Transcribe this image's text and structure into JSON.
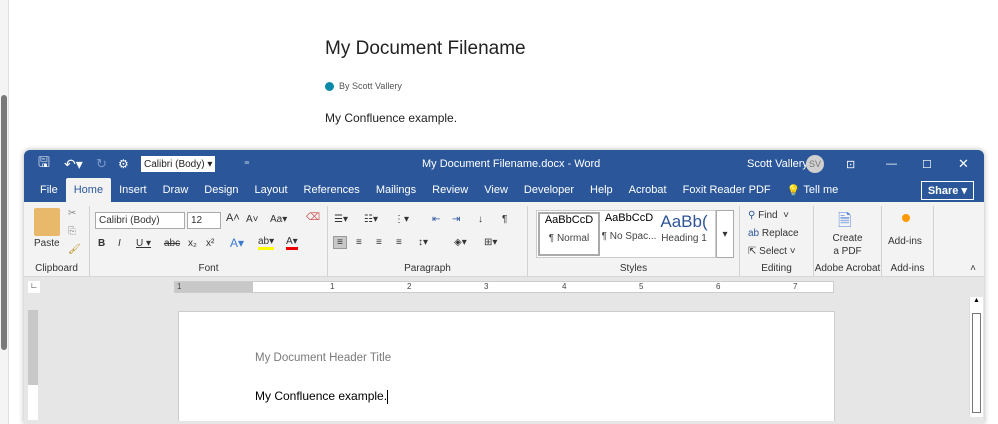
{
  "confluence": {
    "title": "My Document Filename",
    "byline": "By Scott Vallery",
    "body": "My Confluence example."
  },
  "word": {
    "qat": {
      "font": "Calibri (Body)",
      "font_caret": "▾",
      "customize": "⁼"
    },
    "title": "My Document Filename.docx  -  Word",
    "user": "Scott Vallery",
    "initials": "SV",
    "tabs": [
      "File",
      "Home",
      "Insert",
      "Draw",
      "Design",
      "Layout",
      "References",
      "Mailings",
      "Review",
      "View",
      "Developer",
      "Help",
      "Acrobat",
      "Foxit Reader PDF"
    ],
    "tell_me": "Tell me",
    "share": "Share",
    "ribbon": {
      "clipboard": {
        "paste": "Paste",
        "label": "Clipboard"
      },
      "font": {
        "name": "Calibri (Body)",
        "size": "12",
        "label": "Font"
      },
      "paragraph": {
        "label": "Paragraph"
      },
      "styles": {
        "label": "Styles",
        "items": [
          {
            "preview": "AaBbCcD",
            "name": "¶ Normal"
          },
          {
            "preview": "AaBbCcD",
            "name": "¶ No Spac..."
          },
          {
            "preview": "AaBb(",
            "name": "Heading 1"
          }
        ]
      },
      "editing": {
        "find": "Find",
        "replace": "Replace",
        "select": "Select",
        "label": "Editing"
      },
      "acrobat": {
        "create": "Create",
        "create2": "a PDF",
        "label": "Adobe Acrobat"
      },
      "addins": {
        "button": "Add-ins",
        "label": "Add-ins"
      }
    },
    "ruler": [
      "1",
      "1",
      "2",
      "3",
      "4",
      "5",
      "6",
      "7"
    ],
    "document": {
      "header": "My Document Header Title",
      "body": "My Confluence example."
    }
  }
}
